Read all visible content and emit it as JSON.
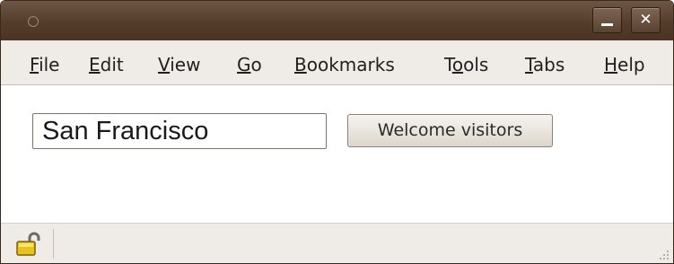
{
  "window": {
    "title": ""
  },
  "menu": {
    "items": [
      {
        "mnemonic": "F",
        "rest": "ile"
      },
      {
        "mnemonic": "E",
        "rest": "dit"
      },
      {
        "mnemonic": "V",
        "rest": "iew"
      },
      {
        "mnemonic": "G",
        "rest": "o"
      },
      {
        "mnemonic": "B",
        "rest": "ookmarks"
      },
      {
        "pre": "T",
        "mnemonic": "o",
        "rest": "ols"
      },
      {
        "mnemonic": "T",
        "rest": "abs"
      },
      {
        "mnemonic": "H",
        "rest": "elp"
      }
    ]
  },
  "form": {
    "city_value": "San Francisco",
    "welcome_button": "Welcome visitors"
  },
  "icons": {
    "status": "lock-icon",
    "minimize": "minimize-icon",
    "close": "close-icon"
  },
  "colors": {
    "titlebar": "#553d2b",
    "chrome": "#efebe7",
    "lock": "#e8c21a"
  }
}
